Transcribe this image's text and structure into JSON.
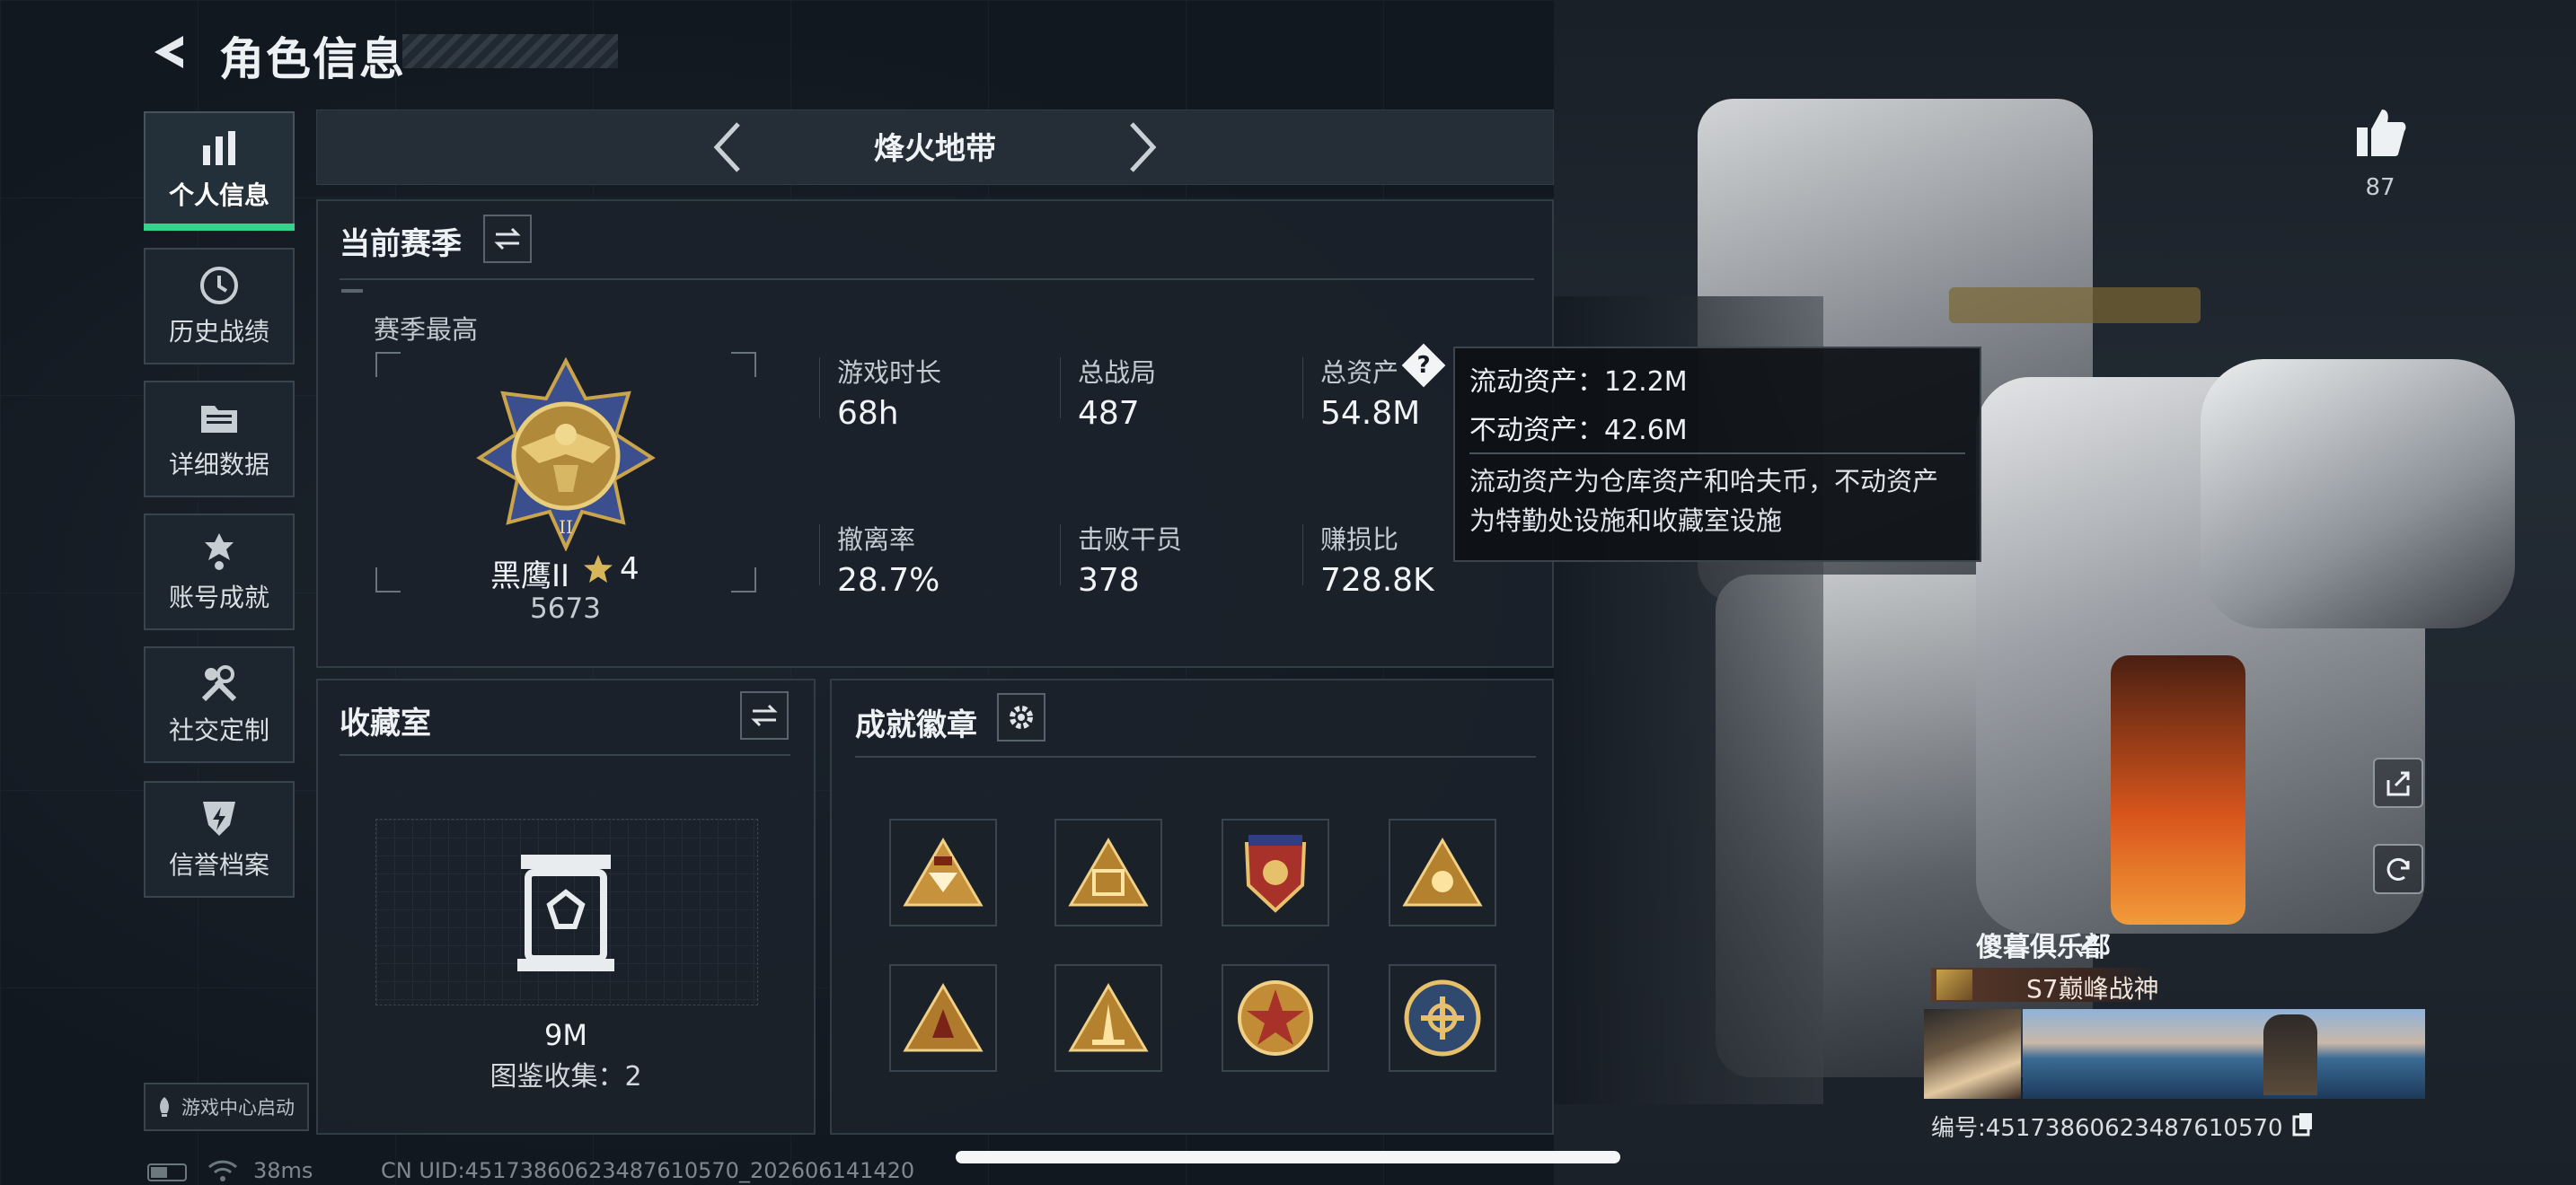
{
  "header": {
    "title": "角色信息"
  },
  "sidebar": {
    "items": [
      {
        "label": "个人信息",
        "icon": "bar-chart-icon",
        "active": true
      },
      {
        "label": "历史战绩",
        "icon": "clock-icon"
      },
      {
        "label": "详细数据",
        "icon": "folder-icon"
      },
      {
        "label": "账号成就",
        "icon": "medal-icon"
      },
      {
        "label": "社交定制",
        "icon": "wrench-icon"
      },
      {
        "label": "信誉档案",
        "icon": "shield-bolt-icon"
      }
    ],
    "launch_label": "游戏中心启动"
  },
  "mode": {
    "title": "烽火地带"
  },
  "season": {
    "title": "当前赛季",
    "best_label": "赛季最高",
    "rank_name": "黑鹰II",
    "rank_stars": "4",
    "rank_score": "5673",
    "stats": [
      {
        "label": "游戏时长",
        "value": "68h"
      },
      {
        "label": "总战局",
        "value": "487"
      },
      {
        "label": "总资产",
        "value": "54.8M"
      },
      {
        "label": "撤离率",
        "value": "28.7%"
      },
      {
        "label": "击败干员",
        "value": "378"
      },
      {
        "label": "赚损比",
        "value": "728.8K"
      }
    ]
  },
  "tooltip": {
    "liquid": "流动资产：12.2M",
    "fixed": "不动资产：42.6M",
    "desc_line1": "流动资产为仓库资产和哈夫币，不动资产",
    "desc_line2": "为特勤处设施和收藏室设施"
  },
  "collection": {
    "title": "收藏室",
    "value": "9M",
    "count_text": "图鉴收集：2"
  },
  "achievements": {
    "title": "成就徽章",
    "badges": [
      "badge-1",
      "badge-2",
      "badge-3",
      "badge-4",
      "badge-5",
      "badge-6",
      "badge-7",
      "badge-8"
    ]
  },
  "profile": {
    "likes": "87",
    "club": "傻暮俱乐部",
    "title_tag": "S7巅峰战神",
    "id_text": "编号:4517386062348761057​0"
  },
  "status_bar": {
    "ping": "38ms",
    "uid": "CN UID:4517386062348761057​0_20260614142​0"
  },
  "colors": {
    "accent": "#37d38a",
    "gold": "#c9a44a"
  }
}
